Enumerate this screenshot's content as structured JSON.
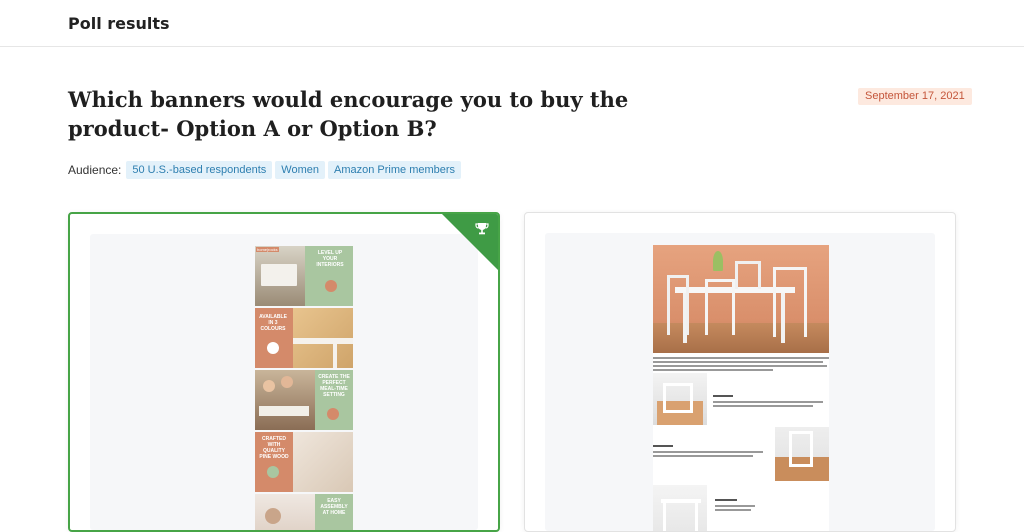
{
  "header": {
    "title": "Poll results"
  },
  "question": "Which banners would encourage you to buy the product- Option A or Option B?",
  "date": "September 17, 2021",
  "audience": {
    "label": "Audience:",
    "tags": [
      "50 U.S.-based respondents",
      "Women",
      "Amazon Prime members"
    ]
  },
  "options": [
    {
      "winner": true,
      "icon": "trophy-icon",
      "tiles": [
        {
          "caption": "LEVEL UP YOUR INTERIORS",
          "brand": "home|rocks"
        },
        {
          "caption": "AVAILABLE IN 3 COLOURS"
        },
        {
          "caption": "CREATE THE PERFECT MEAL-TIME SETTING"
        },
        {
          "caption": "CRAFTED WITH QUALITY PINE WOOD"
        },
        {
          "caption": "EASY ASSEMBLY AT HOME"
        }
      ]
    },
    {
      "winner": false
    }
  ],
  "colors": {
    "winner_border": "#47a447",
    "date_bg": "#fde9df",
    "date_text": "#c4553a",
    "tag_bg": "#e3f1fa",
    "tag_text": "#2e7fb0",
    "tile_green": "#a9c6a0",
    "tile_peach": "#d48a6a"
  }
}
